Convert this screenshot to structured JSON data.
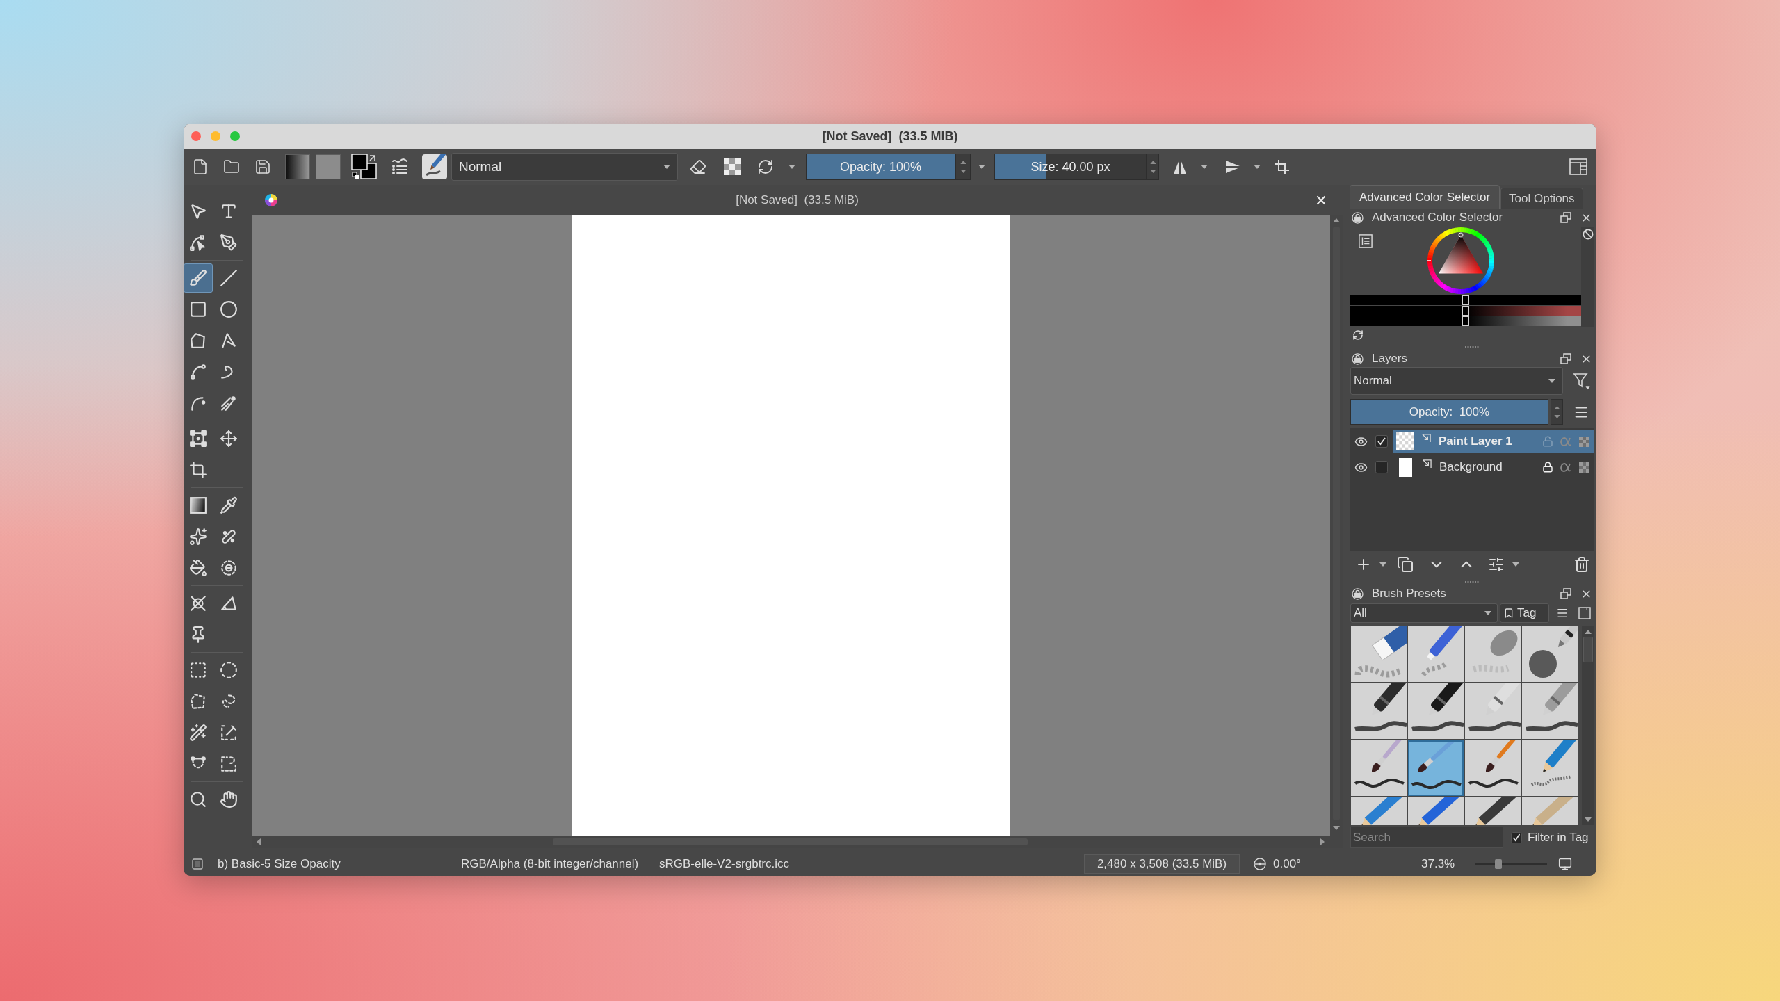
{
  "window": {
    "title": "[Not Saved]  (33.5 MiB)"
  },
  "toolbar": {
    "blend_mode": "Normal",
    "opacity": {
      "label": "Opacity: 100%",
      "level": 1
    },
    "size": {
      "label": "Size: 40.00 px",
      "level": 0.34
    }
  },
  "toolbox": {
    "groups": [
      {
        "tools": [
          {
            "selected": false
          },
          {
            "selected": false
          },
          {
            "selected": false
          },
          {
            "selected": false
          }
        ]
      },
      {
        "tools": [
          {
            "selected": true
          },
          {
            "selected": false
          },
          {
            "selected": false
          },
          {
            "selected": false
          },
          {
            "selected": false
          },
          {
            "selected": false
          },
          {
            "selected": false
          },
          {
            "selected": false
          },
          {
            "selected": false
          },
          {
            "selected": false
          }
        ]
      },
      {
        "tools": [
          {
            "selected": false
          },
          {
            "selected": false
          },
          {
            "selected": false
          }
        ]
      },
      {
        "tools": [
          {
            "selected": false
          },
          {
            "selected": false
          },
          {
            "selected": false
          },
          {
            "selected": false
          },
          {
            "selected": false
          },
          {
            "selected": false
          }
        ]
      },
      {
        "tools": [
          {
            "selected": false
          },
          {
            "selected": false
          },
          {
            "selected": false
          }
        ]
      },
      {
        "tools": [
          {
            "selected": false
          },
          {
            "selected": false
          },
          {
            "selected": false
          },
          {
            "selected": false
          },
          {
            "selected": false
          },
          {
            "selected": false
          },
          {
            "selected": false
          },
          {
            "selected": false
          }
        ]
      },
      {
        "tools": [
          {
            "selected": false
          },
          {
            "selected": false
          }
        ]
      }
    ]
  },
  "document": {
    "title": "[Not Saved]  (33.5 MiB)"
  },
  "docker_tabs": [
    {
      "label": "Advanced Color Selector",
      "selected": true
    },
    {
      "label": "Tool Options",
      "selected": false
    }
  ],
  "color_selector": {
    "title": "Advanced Color Selector",
    "sliders": [
      {
        "level": 0.5,
        "color": "#000000"
      },
      {
        "level": 0.5,
        "color": "#a44545"
      },
      {
        "level": 0.5,
        "color": "#8f8f8f"
      }
    ]
  },
  "layers": {
    "title": "Layers",
    "blend_mode": "Normal",
    "opacity": {
      "label": "Opacity:  100%",
      "level": 1
    },
    "items": [
      {
        "name": "Paint Layer 1",
        "selected": true,
        "visible": true,
        "checked": true,
        "locked": false
      },
      {
        "name": "Background",
        "selected": false,
        "visible": true,
        "checked": false,
        "locked": true
      }
    ]
  },
  "brush_presets": {
    "title": "Brush Presets",
    "tag_filter": "All",
    "tag_button": "Tag",
    "presets": [
      {
        "selected": false
      },
      {
        "selected": false
      },
      {
        "selected": false
      },
      {
        "selected": false
      },
      {
        "selected": false
      },
      {
        "selected": false
      },
      {
        "selected": false
      },
      {
        "selected": false
      },
      {
        "selected": false
      },
      {
        "selected": true
      },
      {
        "selected": false
      },
      {
        "selected": false
      },
      {
        "selected": false
      },
      {
        "selected": false
      },
      {
        "selected": false
      },
      {
        "selected": false
      }
    ],
    "search": {
      "placeholder": "Search"
    },
    "filter_in_tag": {
      "label": "Filter in Tag",
      "checked": true
    }
  },
  "status_bar": {
    "brush_preset": "b) Basic-5 Size Opacity",
    "color_model": "RGB/Alpha (8-bit integer/channel)",
    "color_profile": "sRGB-elle-V2-srgbtrc.icc",
    "image_size": "2,480 x 3,508 (33.5 MiB)",
    "rotation": "0.00°",
    "zoom": {
      "label": "37.3%",
      "level": 0.33
    }
  }
}
